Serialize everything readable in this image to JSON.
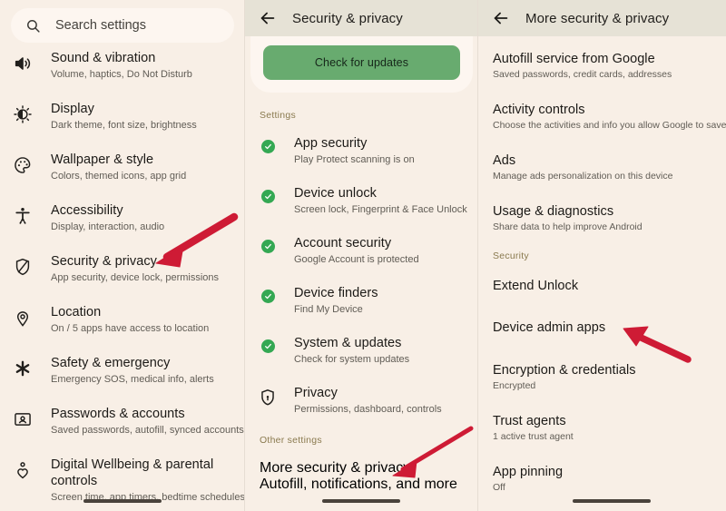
{
  "panels": {
    "left": {
      "search": {
        "placeholder": "Search settings",
        "icon": "search-icon"
      },
      "items": [
        {
          "title": "Sound & vibration",
          "subtitle": "Volume, haptics, Do Not Disturb",
          "icon": "speaker-icon"
        },
        {
          "title": "Display",
          "subtitle": "Dark theme, font size, brightness",
          "icon": "brightness-icon"
        },
        {
          "title": "Wallpaper & style",
          "subtitle": "Colors, themed icons, app grid",
          "icon": "palette-icon"
        },
        {
          "title": "Accessibility",
          "subtitle": "Display, interaction, audio",
          "icon": "accessibility-icon"
        },
        {
          "title": "Security & privacy",
          "subtitle": "App security, device lock, permissions",
          "icon": "shield-slash-icon"
        },
        {
          "title": "Location",
          "subtitle": "On / 5 apps have access to location",
          "icon": "location-pin-icon"
        },
        {
          "title": "Safety & emergency",
          "subtitle": "Emergency SOS, medical info, alerts",
          "icon": "asterisk-icon"
        },
        {
          "title": "Passwords & accounts",
          "subtitle": "Saved passwords, autofill, synced accounts",
          "icon": "id-badge-icon"
        },
        {
          "title": "Digital Wellbeing & parental controls",
          "subtitle": "Screen time, app timers, bedtime schedules",
          "icon": "wellbeing-icon"
        }
      ]
    },
    "mid": {
      "appbar": {
        "title": "Security & privacy",
        "back_icon": "back-arrow-icon"
      },
      "update_button": "Check for updates",
      "settings_label": "Settings",
      "items": [
        {
          "title": "App security",
          "subtitle": "Play Protect scanning is on",
          "icon": "green-check-icon"
        },
        {
          "title": "Device unlock",
          "subtitle": "Screen lock, Fingerprint & Face Unlock",
          "icon": "green-check-icon"
        },
        {
          "title": "Account security",
          "subtitle": "Google Account is protected",
          "icon": "green-check-icon"
        },
        {
          "title": "Device finders",
          "subtitle": "Find My Device",
          "icon": "green-check-icon"
        },
        {
          "title": "System & updates",
          "subtitle": "Check for system updates",
          "icon": "green-check-icon"
        },
        {
          "title": "Privacy",
          "subtitle": "Permissions, dashboard, controls",
          "icon": "shield-lock-icon"
        }
      ],
      "other_label": "Other settings",
      "other_items": [
        {
          "title": "More security & privacy",
          "subtitle": "Autofill, notifications, and more"
        }
      ]
    },
    "right": {
      "appbar": {
        "title": "More security & privacy",
        "back_icon": "back-arrow-icon"
      },
      "items": [
        {
          "title": "Autofill service from Google",
          "subtitle": "Saved passwords, credit cards, addresses"
        },
        {
          "title": "Activity controls",
          "subtitle": "Choose the activities and info you allow Google to save"
        },
        {
          "title": "Ads",
          "subtitle": "Manage ads personalization on this device"
        },
        {
          "title": "Usage & diagnostics",
          "subtitle": "Share data to help improve Android"
        }
      ],
      "security_label": "Security",
      "security_items": [
        {
          "title": "Extend Unlock",
          "subtitle": ""
        },
        {
          "title": "Device admin apps",
          "subtitle": ""
        },
        {
          "title": "Encryption & credentials",
          "subtitle": "Encrypted"
        },
        {
          "title": "Trust agents",
          "subtitle": "1 active trust agent"
        },
        {
          "title": "App pinning",
          "subtitle": "Off"
        }
      ]
    }
  },
  "annotations": {
    "arrow_color": "#ce1b35",
    "arrows": [
      {
        "name": "arrow-to-security-privacy",
        "points_at": "Security & privacy"
      },
      {
        "name": "arrow-to-more-security-privacy",
        "points_at": "More security & privacy"
      },
      {
        "name": "arrow-to-device-admin-apps",
        "points_at": "Device admin apps"
      }
    ]
  },
  "colors": {
    "background": "#f8efe6",
    "appbar": "#e6e2d6",
    "card": "#fdf6f0",
    "accent_green": "#68ab6f",
    "check_green": "#34a853",
    "section_label": "#8a7a4f",
    "arrow_red": "#ce1b35"
  }
}
